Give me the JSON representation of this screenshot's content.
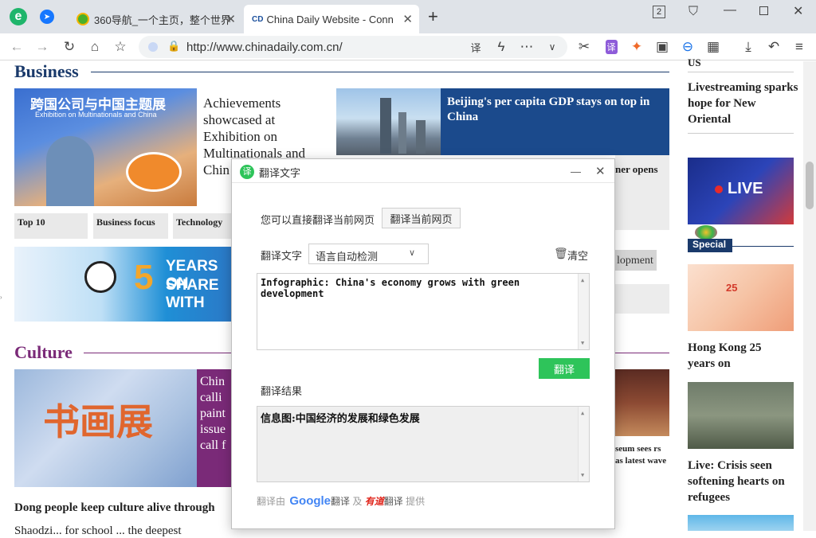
{
  "browser": {
    "tabs": [
      {
        "title": "360导航_一个主页，整个世界",
        "close": "✕"
      },
      {
        "title": "China Daily Website - Conn",
        "close": "✕",
        "favicon": "CD"
      }
    ],
    "new_tab": "+",
    "tab_count": "2",
    "url": "http://www.chinadaily.com.cn/",
    "colors": {
      "accent": "#1a73e8",
      "tabbar": "#dfe3e8"
    }
  },
  "page": {
    "business": {
      "title": "Business",
      "headline1": "Achievements showcased at Exhibition on Multinationals and Chin",
      "headline2": "Beijing's per capita GDP stays on top in China",
      "headline3_tail": "ner opens",
      "nav": [
        "Top 10",
        "Business focus",
        "Technology"
      ],
      "banner_text1": "YEARS ON",
      "banner_text2": "SHARE WITH",
      "img1_caption_cn": "跨国公司与中国主题展",
      "img1_caption_en": "Exhibition on Multinationals and China",
      "partial_highlight": "lopment"
    },
    "culture": {
      "title": "Culture",
      "headline_partial": "Chin calli paint issue call f",
      "story1": "Dong people keep culture alive through",
      "story2": "Shaodzi... for school ... the deepest",
      "museum_partial": "seum sees rs as latest wave",
      "img_title": "书画展"
    },
    "sidebar": {
      "top_partial": "US",
      "headline1": "Livestreaming sparks hope for New Oriental",
      "live_label": "LIVE",
      "special_label": "Special",
      "headline2": "Hong Kong 25 years on",
      "headline3": "Live: Crisis seen softening hearts on refugees"
    }
  },
  "dialog": {
    "title": "翻译文字",
    "minimize": "—",
    "close": "✕",
    "translate_page_hint": "您可以直接翻译当前网页",
    "translate_page_button": "翻译当前网页",
    "source_label": "翻译文字",
    "language_select": "语言自动检测",
    "clear_label": "清空",
    "source_text": "Infographic: China's economy grows with green development",
    "translate_button": "翻译",
    "result_label": "翻译结果",
    "result_text": "信息图:中国经济的发展和绿色发展",
    "footer_prefix": "翻译由",
    "footer_google": "Google",
    "footer_google_suffix": "翻译",
    "footer_and": "及",
    "footer_youdao": "有道",
    "footer_youdao_suffix": "翻译",
    "footer_suffix": "提供",
    "colors": {
      "green": "#2ec45a",
      "business": "#1a3a6b",
      "culture": "#7a2a78"
    }
  }
}
